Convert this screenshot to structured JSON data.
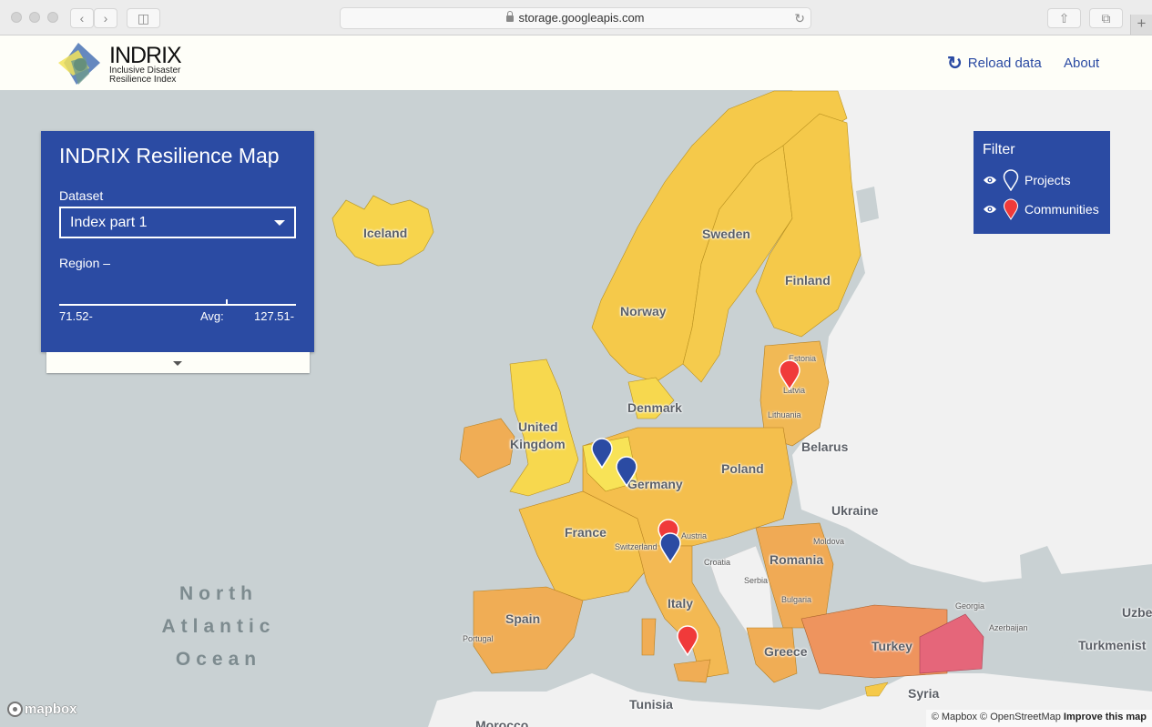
{
  "browser": {
    "url": "storage.googleapis.com"
  },
  "header": {
    "logo_title": "INDRIX",
    "logo_subtitle_line1": "Inclusive Disaster",
    "logo_subtitle_line2": "Resilience Index",
    "reload_label": "Reload data",
    "about_label": "About"
  },
  "panel": {
    "title": "INDRIX Resilience Map",
    "dataset_label": "Dataset",
    "dataset_value": "Index part 1",
    "region_label": "Region –",
    "range_min": "71.52-",
    "avg_label": "Avg:",
    "range_max": "127.51-"
  },
  "filter": {
    "title": "Filter",
    "items": [
      {
        "label": "Projects",
        "pin_color": "#ffffff",
        "visible": true
      },
      {
        "label": "Communities",
        "pin_color": "#f03a3a",
        "visible": true
      }
    ]
  },
  "colors": {
    "panel_bg": "#2b4ba3",
    "water": "#c9d1d3",
    "land_other": "#f1f1f1",
    "choropleth_low": "#f7d44c",
    "choropleth_mid": "#f0a954",
    "choropleth_high": "#e5667a",
    "project_pin": "#2b4ba3",
    "community_pin": "#f03a3a"
  },
  "map": {
    "labels": {
      "iceland": "Iceland",
      "sweden": "Sweden",
      "finland": "Finland",
      "norway": "Norway",
      "estonia": "Estonia",
      "latvia": "Latvia",
      "lithuania": "Lithuania",
      "denmark": "Denmark",
      "belarus": "Belarus",
      "united": "United",
      "kingdom": "Kingdom",
      "germany": "Germany",
      "poland": "Poland",
      "ukraine": "Ukraine",
      "france": "France",
      "austria": "Austria",
      "switzerland": "Switzerland",
      "croatia": "Croatia",
      "moldova": "Moldova",
      "romania": "Romania",
      "serbia": "Serbia",
      "bulgaria": "Bulgaria",
      "italy": "Italy",
      "spain": "Spain",
      "portugal": "Portugal",
      "greece": "Greece",
      "turkey": "Turkey",
      "georgia": "Georgia",
      "azerbaijan": "Azerbaijan",
      "turkmenistan": "Turkmenist",
      "uzbekistan": "Uzbe",
      "syria": "Syria",
      "tunisia": "Tunisia",
      "morocco": "Morocco",
      "ocean_line1": "North",
      "ocean_line2": "Atlantic",
      "ocean_line3": "Ocean"
    },
    "markers": [
      {
        "type": "project",
        "near": "Netherlands"
      },
      {
        "type": "project",
        "near": "Germany west"
      },
      {
        "type": "project",
        "near": "Northern Italy"
      },
      {
        "type": "community",
        "near": "Latvia"
      },
      {
        "type": "community",
        "near": "Austria"
      },
      {
        "type": "community",
        "near": "Sicily"
      }
    ],
    "mapbox_logo": "mapbox",
    "attribution": "© Mapbox © OpenStreetMap",
    "improve_link": "Improve this map"
  }
}
